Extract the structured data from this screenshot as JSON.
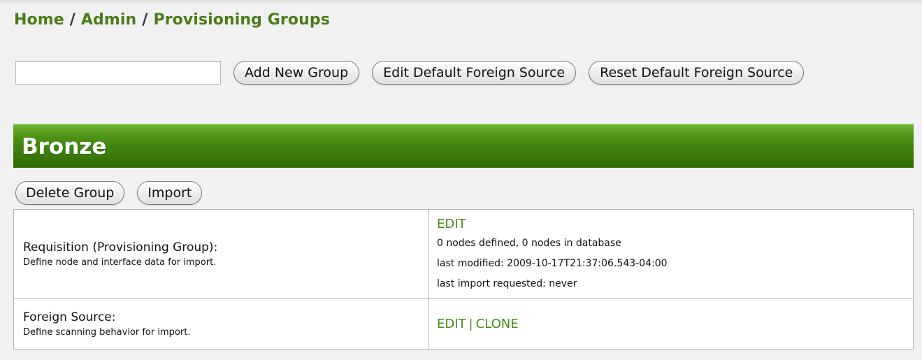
{
  "breadcrumb": {
    "items": [
      "Home",
      "Admin",
      "Provisioning Groups"
    ],
    "separator": "/"
  },
  "toolbar": {
    "search_value": "",
    "add_group_label": "Add New Group",
    "edit_default_label": "Edit Default Foreign Source",
    "reset_default_label": "Reset Default Foreign Source"
  },
  "group": {
    "name": "Bronze",
    "delete_label": "Delete Group",
    "import_label": "Import",
    "requisition": {
      "title": "Requisition (Provisioning Group):",
      "description": "Define node and interface data for import.",
      "edit_label": "EDIT",
      "nodes_status": "0 nodes defined, 0 nodes in database",
      "last_modified": "last modified: 2009-10-17T21:37:06.543-04:00",
      "last_import": "last import requested: never"
    },
    "foreign_source": {
      "title": "Foreign Source:",
      "description": "Define scanning behavior for import.",
      "edit_label": "EDIT",
      "separator": "|",
      "clone_label": "CLONE"
    }
  },
  "colors": {
    "link_green": "#4a8a1a",
    "header_green": "#3a7a0c",
    "page_bg": "#f1f1f1"
  }
}
